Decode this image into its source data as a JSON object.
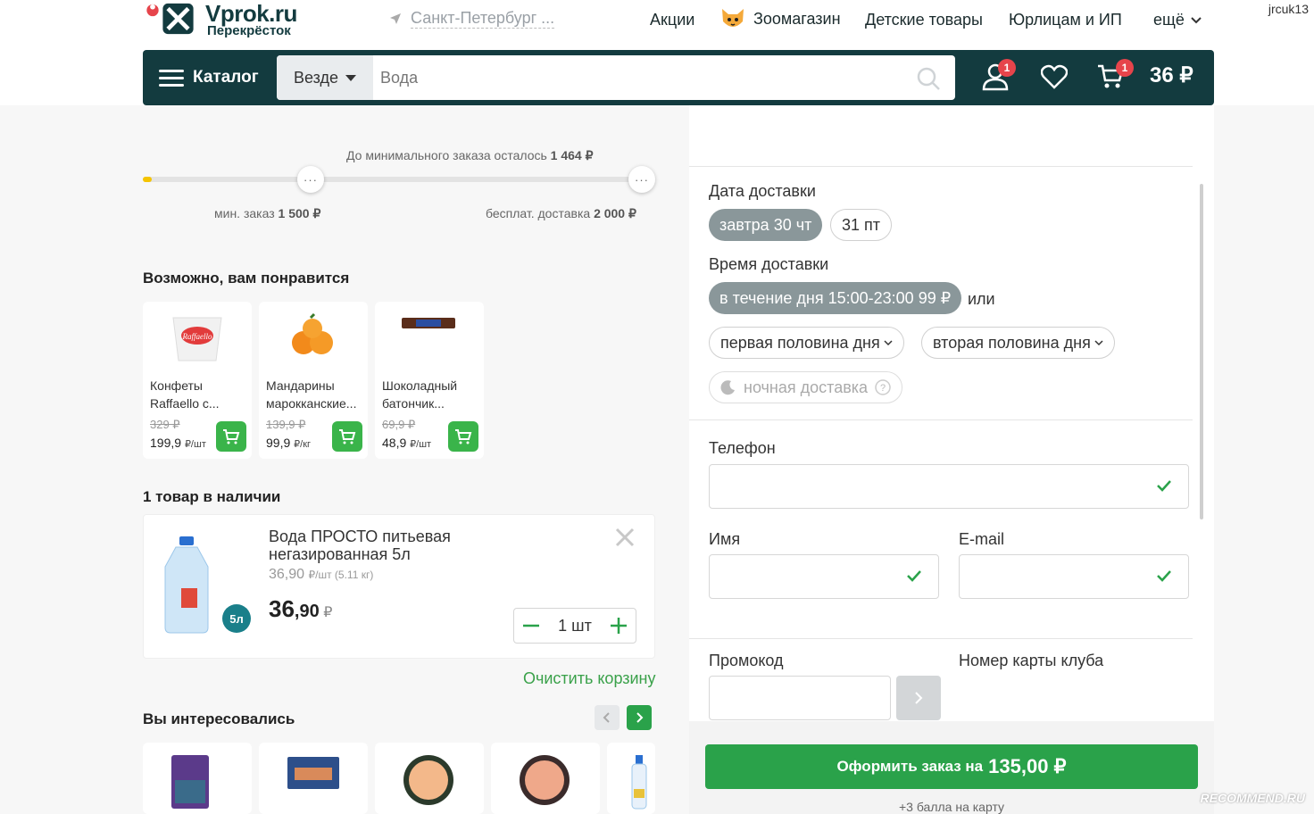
{
  "header": {
    "logo_title": "Vprok.ru",
    "logo_subtitle": "Перекрёсток",
    "city": "Санкт-Петербург ...",
    "nav": [
      "Акции",
      "Зоомагазин",
      "Детские товары",
      "Юрлицам и ИП",
      "ещё"
    ],
    "username": "jrcuk13"
  },
  "toolbar": {
    "catalog_label": "Каталог",
    "scope_label": "Везде",
    "search_placeholder": "Вода",
    "profile_badge": "1",
    "cart_badge": "1",
    "cart_total": "36 ₽"
  },
  "progress": {
    "remaining_label": "До минимального заказа осталось",
    "remaining_value": "1 464 ₽",
    "min_label": "мин. заказ",
    "min_value": "1 500 ₽",
    "free_label": "бесплат. доставка",
    "free_value": "2 000 ₽",
    "knob_text": "···",
    "fill_fraction": 0.018
  },
  "recommended": {
    "title": "Возможно, вам понравится",
    "items": [
      {
        "name1": "Конфеты",
        "name2": "Raffaello с...",
        "old": "329 ₽",
        "price": "199,9",
        "unit": "₽/шт"
      },
      {
        "name1": "Мандарины",
        "name2": "марокканские...",
        "old": "139,9 ₽",
        "price": "99,9",
        "unit": "₽/кг"
      },
      {
        "name1": "Шоколадный",
        "name2": "батончик...",
        "old": "69,9 ₽",
        "price": "48,9",
        "unit": "₽/шт"
      }
    ]
  },
  "cart": {
    "title": "1 товар в наличии",
    "item": {
      "name1": "Вода ПРОСТО питьевая",
      "name2": "негазированная 5л",
      "unit_price": "36,90",
      "unit_suffix": "₽/шт (5.11 кг)",
      "volume_badge": "5л",
      "price_int": "36",
      "price_frac": ",90",
      "currency": "₽",
      "qty": "1 шт"
    },
    "clear_label": "Очистить корзину"
  },
  "interested": {
    "title": "Вы интересовались"
  },
  "checkout": {
    "date_label": "Дата доставки",
    "dates": [
      "завтра 30 чт",
      "31 пт"
    ],
    "time_label": "Время доставки",
    "time_selected": "в течение дня 15:00-23:00 99 ₽",
    "or_label": "или",
    "time_option1": "первая половина дня",
    "time_option2": "вторая половина дня",
    "night_label": "ночная доставка",
    "phone_label": "Телефон",
    "name_label": "Имя",
    "email_label": "E-mail",
    "promo_label": "Промокод",
    "club_label": "Номер карты клуба",
    "order_prefix": "Оформить заказ на",
    "order_amount": "135,00 ₽",
    "bonus_text": "+3  балла на карту"
  },
  "watermark": "RECOMMEND.RU",
  "colors": {
    "brand_dark": "#133b3f",
    "accent_green": "#2aa24a",
    "badge_red": "#e6444b",
    "progress_yellow": "#f5c400"
  }
}
